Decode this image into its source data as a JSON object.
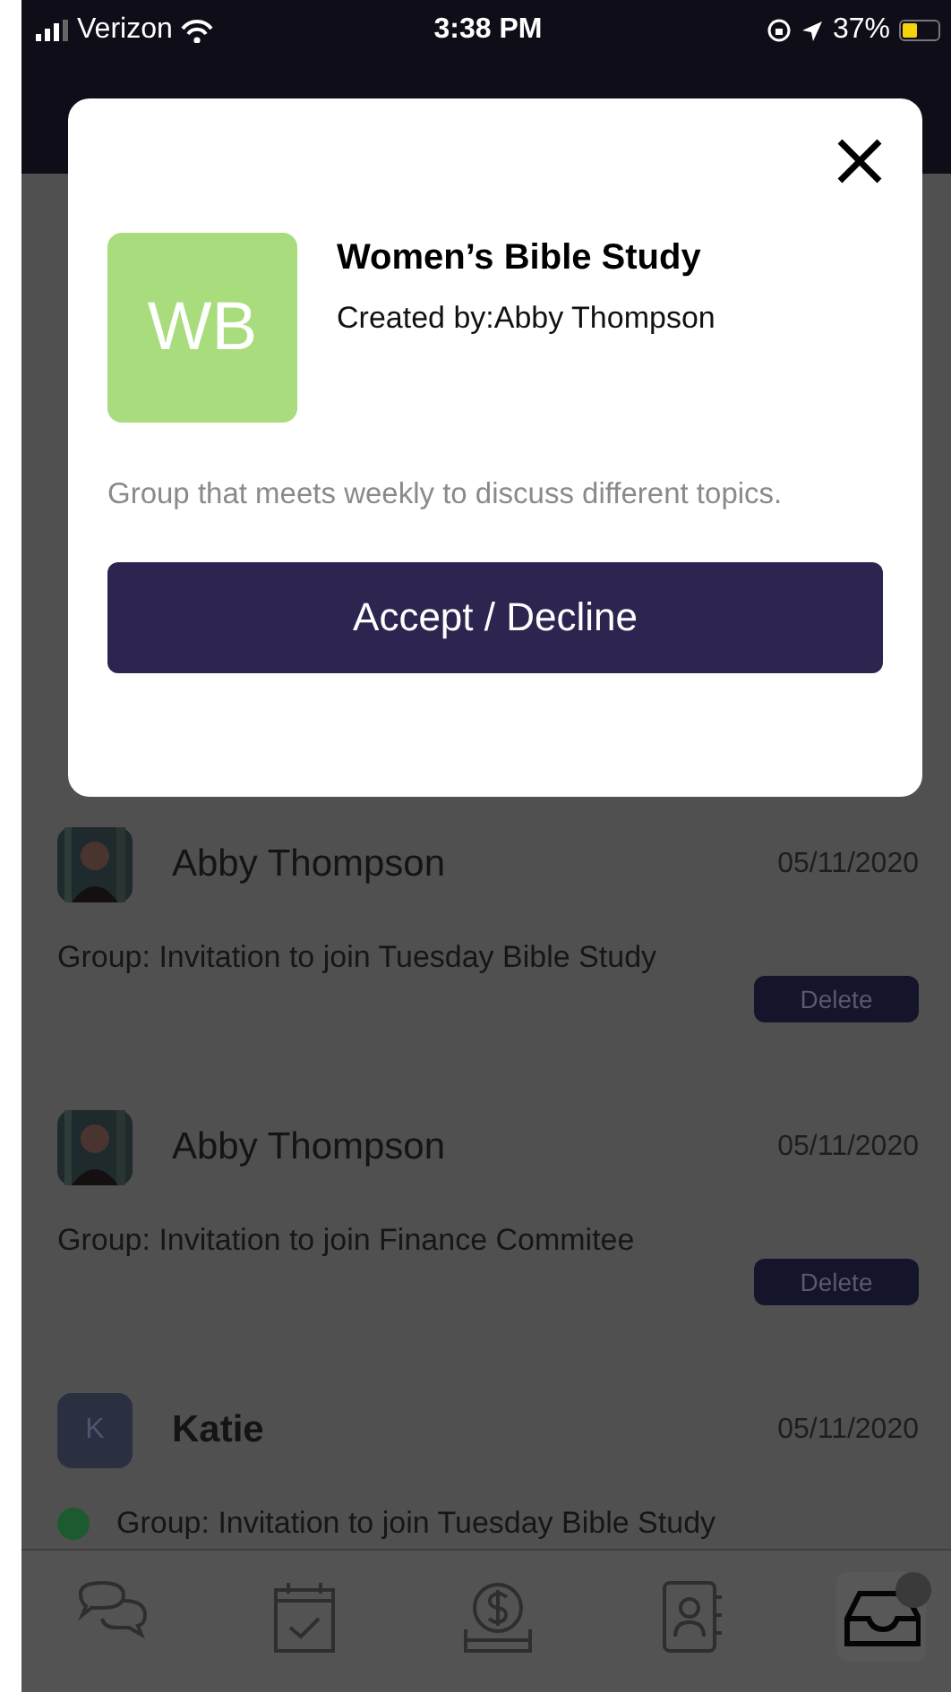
{
  "status_bar": {
    "carrier": "Verizon",
    "time": "3:38 PM",
    "battery": "37%"
  },
  "modal": {
    "initials": "WB",
    "title": "Women’s Bible Study",
    "creator": "Created by:Abby Thompson",
    "description": "Group that meets weekly to discuss different topics.",
    "button": "Accept / Decline"
  },
  "notifications": [
    {
      "name": "Abby Thompson",
      "date": "05/11/2020",
      "message": "Group: Invitation to join Tuesday Bible Study",
      "unread": false,
      "action": "Delete"
    },
    {
      "name": "Abby Thompson",
      "date": "05/11/2020",
      "message": "Group: Invitation to join Finance Commitee",
      "unread": false,
      "action": "Delete"
    },
    {
      "kind": "initials",
      "initials": "K",
      "name": "Katie",
      "date": "05/11/2020",
      "message": "Group: Invitation to join Tuesday Bible Study",
      "unread": true
    }
  ],
  "tab_bar": [
    {
      "kind": "chats",
      "selected": false,
      "badge": false
    },
    {
      "kind": "calendar",
      "selected": false,
      "badge": false
    },
    {
      "kind": "giving",
      "selected": false,
      "badge": false
    },
    {
      "kind": "contacts",
      "selected": false,
      "badge": false
    },
    {
      "kind": "inbox",
      "selected": true,
      "badge": true
    }
  ]
}
